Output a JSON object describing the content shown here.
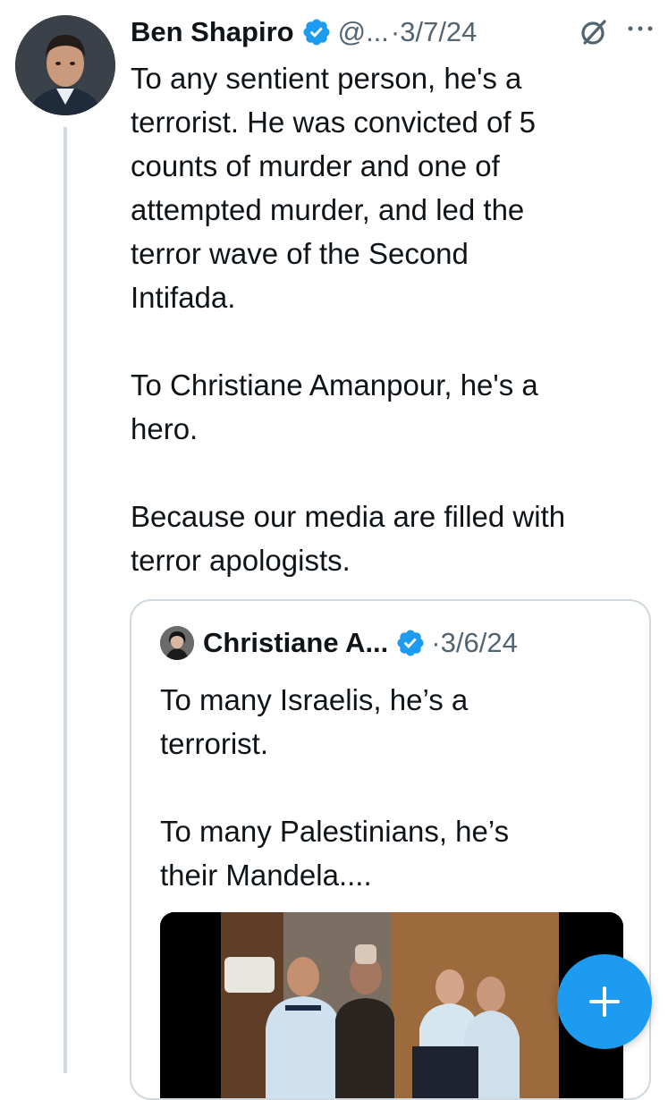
{
  "tweet": {
    "author_name": "Ben Shapiro",
    "handle": "@...",
    "date": "·3/7/24",
    "text": "To any sentient person, he's a\nterrorist. He was convicted of 5\ncounts of murder and one of\nattempted murder, and led the\nterror wave of the Second\nIntifada.\n\nTo Christiane Amanpour, he's a\nhero.\n\nBecause our media are filled with\nterror apologists.",
    "avatar_icon": "profile-photo",
    "verified_icon": "verified-badge-icon",
    "grok_icon": "grok-icon",
    "more_icon": "more-options-icon"
  },
  "quoted_tweet": {
    "author_name": "Christiane A...",
    "date": "·3/6/24",
    "text": "To many Israelis, he’s a\nterrorist.\n\nTo many Palestinians, he’s\ntheir Mandela....",
    "avatar_icon": "profile-photo",
    "verified_icon": "verified-badge-icon",
    "media_icon": "video-thumbnail"
  },
  "compose_button": {
    "icon": "plus-icon"
  },
  "colors": {
    "accent": "#1d9bf0",
    "primary_text": "#0f1419",
    "secondary_text": "#536471",
    "border": "#cfd9de"
  }
}
